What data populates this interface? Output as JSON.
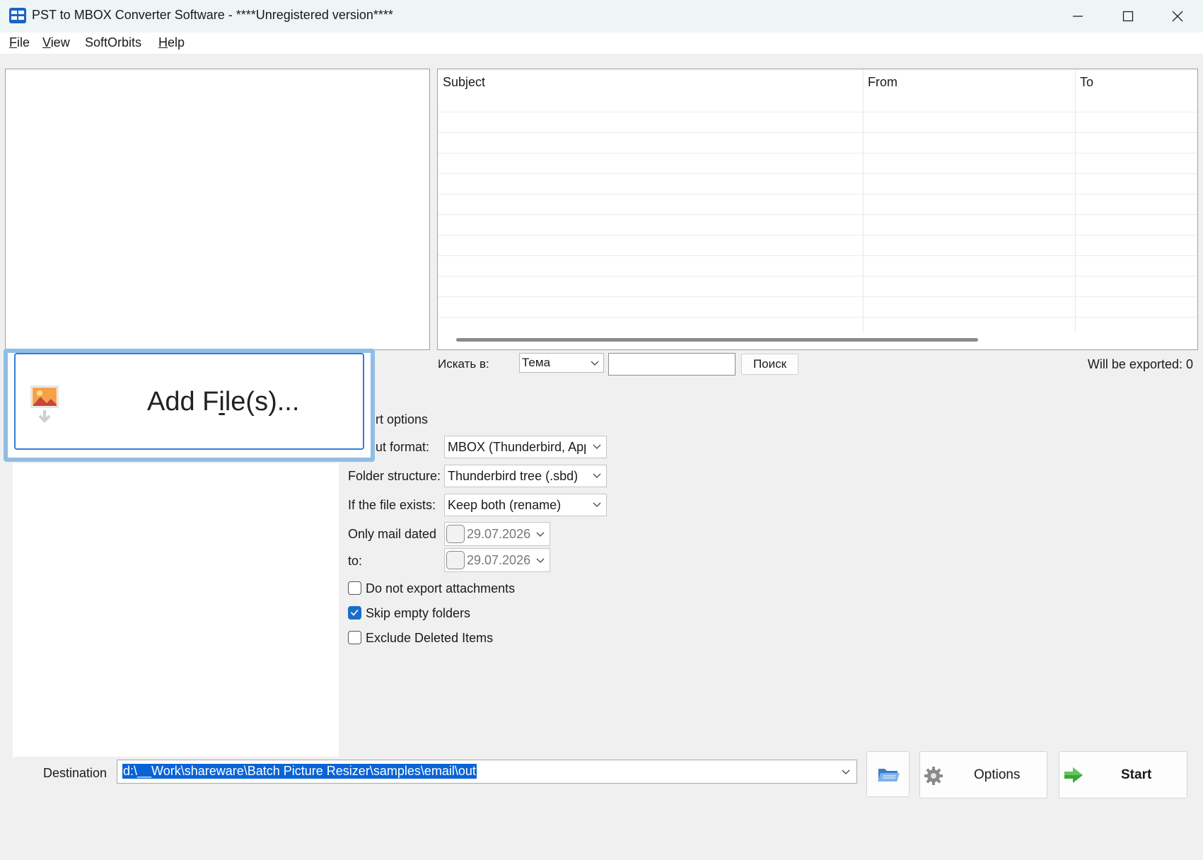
{
  "window": {
    "title": "PST to MBOX Converter Software - ****Unregistered version****",
    "controls": [
      "minimize",
      "maximize",
      "close"
    ]
  },
  "menu": {
    "file": {
      "u": "F",
      "rest": "ile"
    },
    "view": {
      "u": "V",
      "rest": "iew"
    },
    "softorbits": "SoftOrbits",
    "help": {
      "u": "H",
      "rest": "elp"
    }
  },
  "grid": {
    "columns": [
      "Subject",
      "From",
      "To"
    ],
    "rows": []
  },
  "search": {
    "label": "Искать в:",
    "field_value": "Тема",
    "input_value": "",
    "button_label": "Поиск",
    "will_export": "Will be exported: 0"
  },
  "add_files": {
    "before": "Add F",
    "underlined": "i",
    "after": "le(s)..."
  },
  "options": {
    "header": "rt options",
    "output_format_label": "ut format:",
    "output_format_value": "MBOX (Thunderbird, App",
    "folder_structure_label": "Folder structure:",
    "folder_structure_value": "Thunderbird tree (.sbd)",
    "file_exists_label": "If the file exists:",
    "file_exists_value": "Keep both (rename)",
    "date_from_label": "Only mail dated",
    "date_from_value": "29.07.2026",
    "date_to_label": "to:",
    "date_to_value": "29.07.2026",
    "checkboxes": [
      {
        "label": "Do not export attachments",
        "checked": false
      },
      {
        "label": "Skip empty folders",
        "checked": true
      },
      {
        "label": "Exclude Deleted Items",
        "checked": false
      }
    ]
  },
  "bottom": {
    "destination_label": "Destination",
    "destination_value": "d:\\__Work\\shareware\\Batch Picture Resizer\\samples\\email\\out",
    "options_label": "Options",
    "start_label": "Start"
  },
  "colors": {
    "accent": "#0a64d6",
    "add_files_border": "#2f7fd3",
    "add_files_glow": "#90bde6",
    "start_arrow": "#3aa63a"
  },
  "icons": [
    "app-icon",
    "minimize-icon",
    "maximize-icon",
    "close-icon",
    "image-import-icon",
    "chevron-down-icon",
    "folder-open-icon",
    "gear-icon",
    "start-arrow-icon"
  ]
}
